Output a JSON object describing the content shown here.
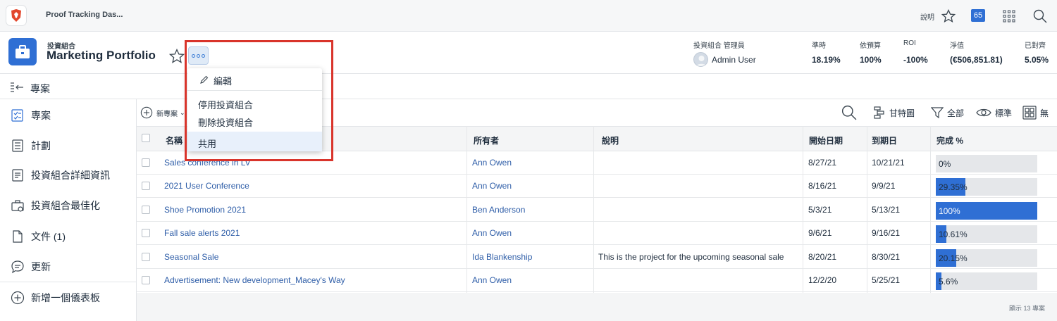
{
  "topbar": {
    "app_title": "Proof Tracking Das...",
    "help_label": "說明",
    "notification_count": "65"
  },
  "header": {
    "object_type": "投資組合",
    "title": "Marketing Portfolio",
    "owner_label": "投資組合 管理員",
    "owner_name": "Admin User",
    "stats": [
      {
        "label": "準時",
        "value": "18.19%"
      },
      {
        "label": "依預算",
        "value": "100%"
      },
      {
        "label": "ROI",
        "value": "-100%"
      },
      {
        "label": "淨值",
        "value": "(€506,851.81)"
      },
      {
        "label": "已對齊",
        "value": "5.05%"
      }
    ]
  },
  "menu": {
    "items": [
      {
        "label": "編輯"
      },
      {
        "label": "停用投資組合"
      },
      {
        "label": "刪除投資組合"
      },
      {
        "label": "共用"
      }
    ]
  },
  "section": {
    "title": "專案"
  },
  "sidebar": {
    "items": [
      {
        "label": "專案"
      },
      {
        "label": "計劃"
      },
      {
        "label": "投資組合詳細資訊"
      },
      {
        "label": "投資組合最佳化"
      },
      {
        "label": "文件 (1)"
      },
      {
        "label": "更新"
      },
      {
        "label": "新增一個儀表板"
      }
    ]
  },
  "toolbar": {
    "new_project": "新專案",
    "gantt": "甘特圖",
    "filter": "全部",
    "view": "標準",
    "grouping": "無"
  },
  "table": {
    "headers": [
      "名稱",
      "所有者",
      "說明",
      "開始日期",
      "到期日",
      "完成 %"
    ],
    "rows": [
      {
        "name": "Sales conference in LV",
        "owner": "Ann Owen",
        "description": "",
        "start": "8/27/21",
        "due": "10/21/21",
        "complete_label": "0%",
        "complete": 0
      },
      {
        "name": "2021 User Conference",
        "owner": "Ann Owen",
        "description": "",
        "start": "8/16/21",
        "due": "9/9/21",
        "complete_label": "29.35%",
        "complete": 29.35
      },
      {
        "name": "Shoe Promotion 2021",
        "owner": "Ben Anderson",
        "description": "",
        "start": "5/3/21",
        "due": "5/13/21",
        "complete_label": "100%",
        "complete": 100
      },
      {
        "name": "Fall sale alerts 2021",
        "owner": "Ann Owen",
        "description": "",
        "start": "9/6/21",
        "due": "9/16/21",
        "complete_label": "10.61%",
        "complete": 10.61
      },
      {
        "name": "Seasonal Sale",
        "owner": "Ida Blankenship",
        "description": "This is the project for the upcoming seasonal sale",
        "start": "8/20/21",
        "due": "8/30/21",
        "complete_label": "20.15%",
        "complete": 20.15
      },
      {
        "name": "Advertisement: New development_Macey's Way",
        "owner": "Ann Owen",
        "description": "",
        "start": "12/2/20",
        "due": "5/25/21",
        "complete_label": "5.6%",
        "complete": 5.6
      }
    ],
    "footer": "顯示 13 專案"
  },
  "colors": {
    "accent": "#2f6fd4",
    "link": "#2f5ea8",
    "highlight": "#d9342b"
  }
}
